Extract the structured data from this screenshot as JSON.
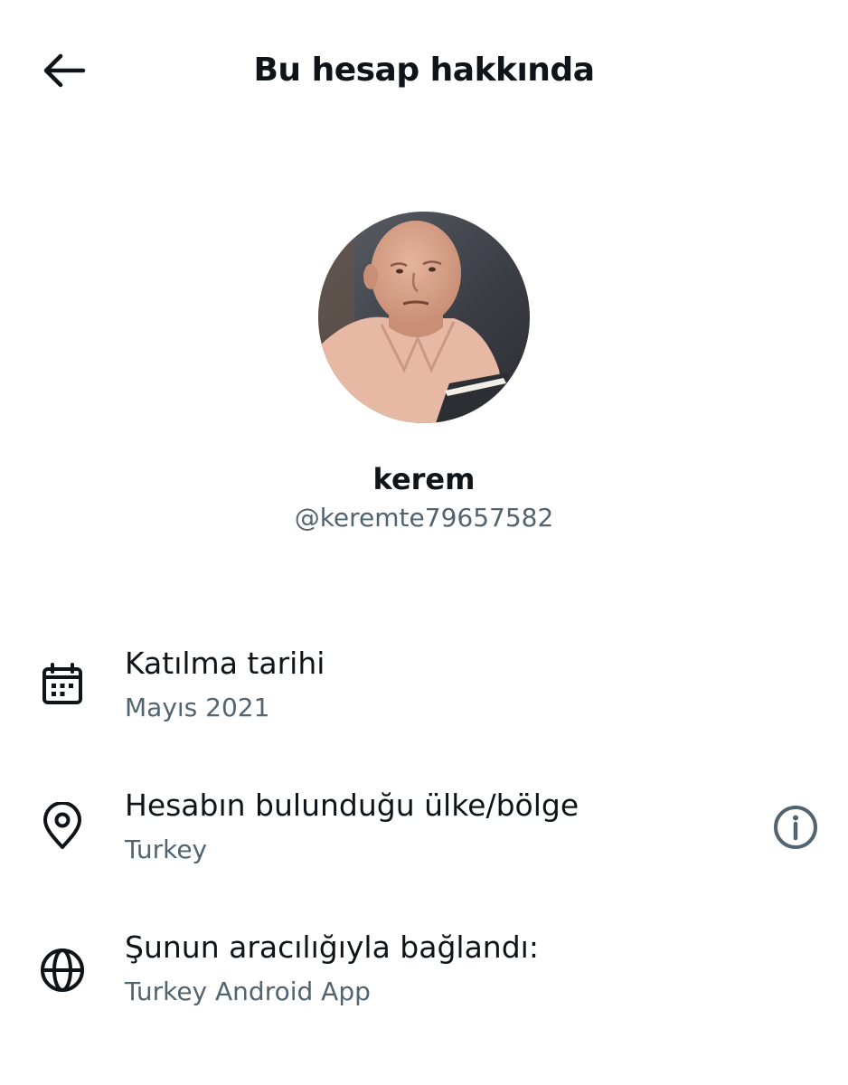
{
  "header": {
    "title": "Bu hesap hakkında",
    "back_icon": "arrow-left-icon"
  },
  "profile": {
    "display_name": "kerem",
    "handle": "@keremte79657582",
    "avatar_icon": "avatar-photo"
  },
  "info": [
    {
      "icon": "calendar-icon",
      "title": "Katılma tarihi",
      "value": "Mayıs 2021"
    },
    {
      "icon": "location-pin-icon",
      "title": "Hesabın bulunduğu ülke/bölge",
      "value": "Turkey",
      "action_icon": "info-icon"
    },
    {
      "icon": "globe-icon",
      "title": "Şunun aracılığıyla bağlandı:",
      "value": "Turkey Android App"
    }
  ],
  "colors": {
    "text_primary": "#0f1419",
    "text_secondary": "#536471",
    "background": "#ffffff"
  }
}
